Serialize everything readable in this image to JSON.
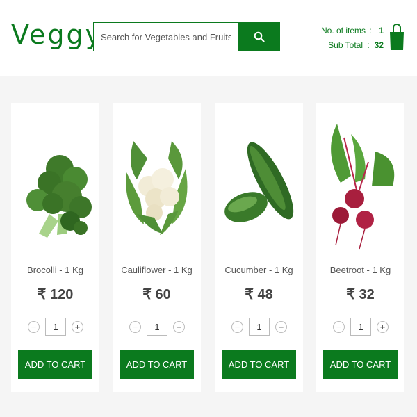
{
  "header": {
    "logo": "Veggy",
    "search_placeholder": "Search for Vegetables and Fruits",
    "cart": {
      "items_label": "No. of items",
      "items_value": "1",
      "subtotal_label": "Sub Total",
      "subtotal_value": "32",
      "separator": ":"
    }
  },
  "colors": {
    "brand": "#0b7a1e",
    "background": "#f5f5f5"
  },
  "products": [
    {
      "name": "Brocolli - 1 Kg",
      "price": "₹ 120",
      "qty": "1",
      "button": "ADD TO CART",
      "icon": "broccoli-image"
    },
    {
      "name": "Cauliflower - 1 Kg",
      "price": "₹ 60",
      "qty": "1",
      "button": "ADD TO CART",
      "icon": "cauliflower-image"
    },
    {
      "name": "Cucumber - 1 Kg",
      "price": "₹ 48",
      "qty": "1",
      "button": "ADD TO CART",
      "icon": "cucumber-image"
    },
    {
      "name": "Beetroot - 1 Kg",
      "price": "₹ 32",
      "qty": "1",
      "button": "ADD TO CART",
      "icon": "beetroot-image"
    }
  ],
  "qty_controls": {
    "minus": "−",
    "plus": "+"
  }
}
